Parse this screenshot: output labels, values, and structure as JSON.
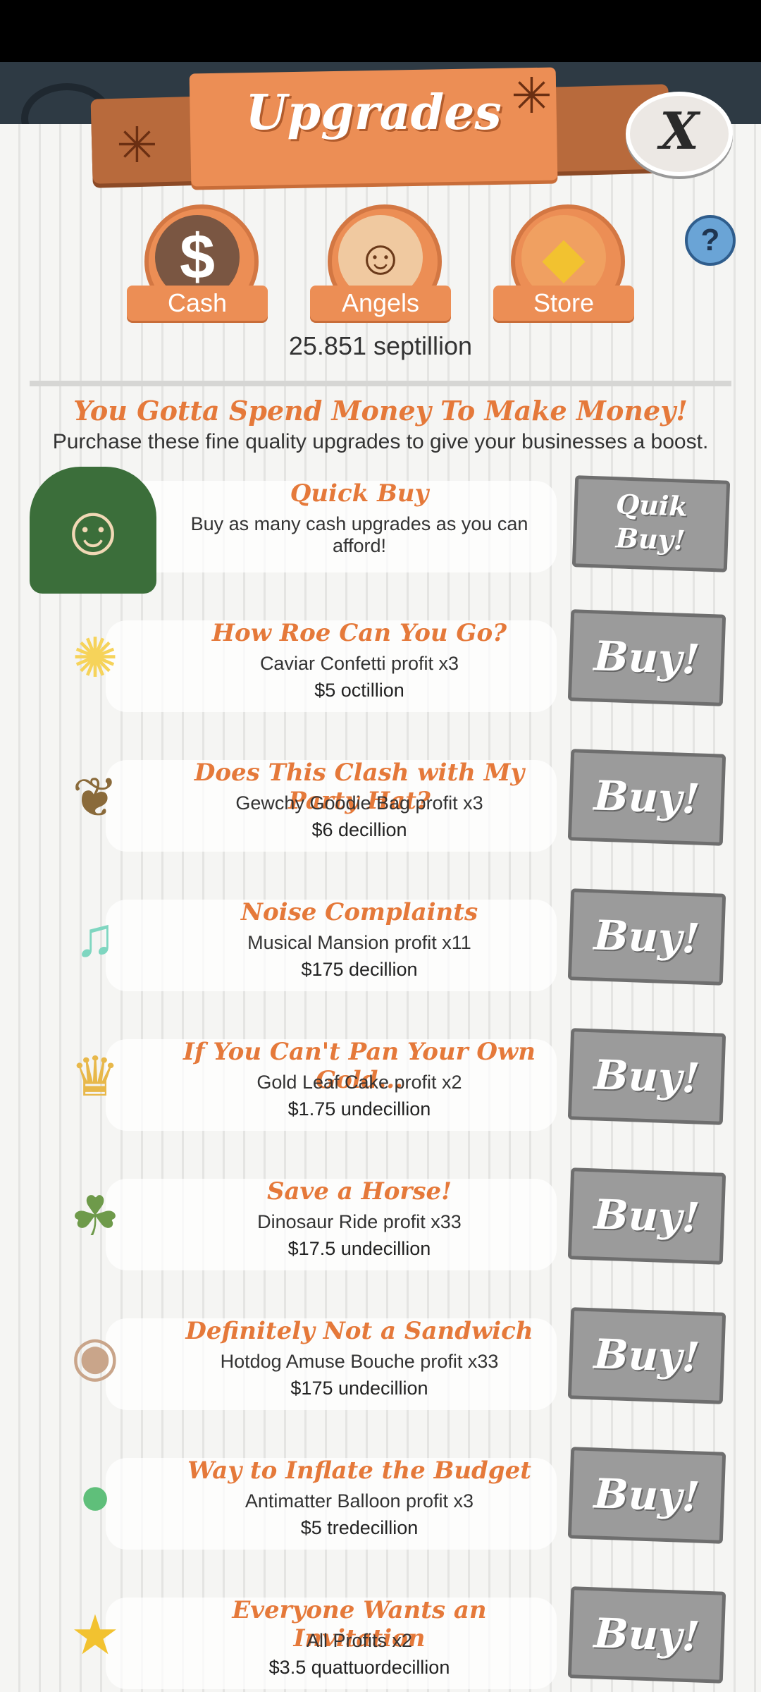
{
  "header": {
    "title": "Upgrades",
    "close_label": "X",
    "help_label": "?"
  },
  "categories": [
    {
      "label": "Cash",
      "glyph": "$"
    },
    {
      "label": "Angels",
      "glyph": "☺"
    },
    {
      "label": "Store",
      "glyph": "◆"
    }
  ],
  "cash_amount": "25.851 septillion",
  "headline": "You Gotta Spend Money To Make Money!",
  "subline": "Purchase these fine quality upgrades to give your businesses a boost.",
  "quick_buy": {
    "title": "Quick Buy",
    "desc": "Buy as many cash upgrades as you can afford!",
    "button": [
      "Quik",
      "Buy!"
    ]
  },
  "upgrades": [
    {
      "title": "How Roe Can You Go?",
      "desc": "Caviar Confetti profit x3",
      "price": "$5 octillion",
      "button": "Buy!",
      "icon": "confetti-icon",
      "glyph": "✺",
      "color": "#f6d35a"
    },
    {
      "title": "Does This Clash with My Party Hat?",
      "desc": "Gewchy Goodie Bag profit x3",
      "price": "$6 decillion",
      "button": "Buy!",
      "icon": "goodie-bag-icon",
      "glyph": "❦",
      "color": "#8a6a3a"
    },
    {
      "title": "Noise Complaints",
      "desc": "Musical Mansion profit x11",
      "price": "$175 decillion",
      "button": "Buy!",
      "icon": "mansion-icon",
      "glyph": "♫",
      "color": "#7fd6c0"
    },
    {
      "title": "If You Can't Pan Your Own Gold...",
      "desc": "Gold Leaf Cake profit x2",
      "price": "$1.75 undecillion",
      "button": "Buy!",
      "icon": "cake-icon",
      "glyph": "♛",
      "color": "#e8b84a"
    },
    {
      "title": "Save a Horse!",
      "desc": "Dinosaur Ride profit x33",
      "price": "$17.5 undecillion",
      "button": "Buy!",
      "icon": "dinosaur-icon",
      "glyph": "☘",
      "color": "#6e9a4a"
    },
    {
      "title": "Definitely Not a Sandwich",
      "desc": "Hotdog Amuse Bouche profit x33",
      "price": "$175 undecillion",
      "button": "Buy!",
      "icon": "hotdog-icon",
      "glyph": "◉",
      "color": "#c9a58a"
    },
    {
      "title": "Way to Inflate the Budget",
      "desc": "Antimatter Balloon profit x3",
      "price": "$5 tredecillion",
      "button": "Buy!",
      "icon": "balloon-icon",
      "glyph": "●",
      "color": "#5fbf7a"
    },
    {
      "title": "Everyone Wants an Invitation",
      "desc": "All Profits x2",
      "price": "$3.5 quattuordecillion",
      "button": "Buy!",
      "icon": "top-hat-icon",
      "glyph": "★",
      "color": "#f2c230"
    }
  ]
}
